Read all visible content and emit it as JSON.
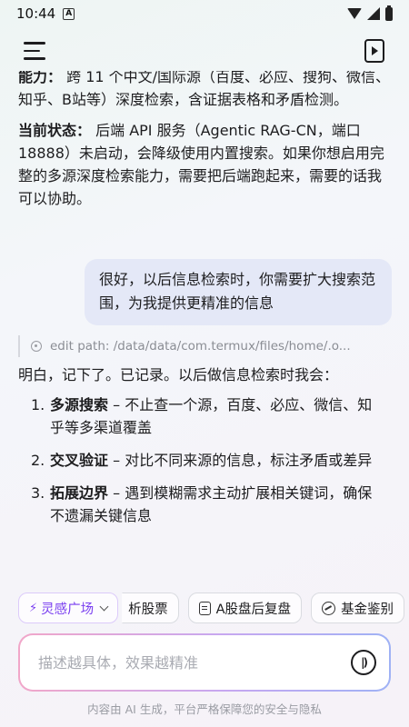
{
  "status_bar": {
    "time": "10:44",
    "app_badge": "A"
  },
  "header": {
    "menu_icon": "menu-icon",
    "video_icon": "video-icon"
  },
  "messages": {
    "cut_label": "能力：",
    "cut_text": " 跨 11 个中文/国际源（百度、必应、搜狗、微信、知乎、B站等）深度检索，含证据表格和矛盾检测。",
    "status_label": "当前状态：",
    "status_text": " 后端 API 服务（Agentic RAG-CN，端口 18888）未启动，会降级使用内置搜索。如果你想启用完整的多源深度检索能力，需要把后端跑起来，需要的话我可以协助。",
    "user_message": "很好，以后信息检索时，你需要扩大搜索范围，为我提供更精准的信息",
    "tool_call": "edit path: /data/data/com.termux/files/home/.o...",
    "reply_intro": "明白，记下了。已记录。以后做信息检索时我会：",
    "list": [
      {
        "num": "1.",
        "title": "多源搜索",
        "text": " – 不止查一个源，百度、必应、微信、知乎等多渠道覆盖"
      },
      {
        "num": "2.",
        "title": "交叉验证",
        "text": " – 对比不同来源的信息，标注矛盾或差异"
      },
      {
        "num": "3.",
        "title": "拓展边界",
        "text": " – 遇到模糊需求主动扩展相关键词，确保不遗漏关键信息"
      }
    ]
  },
  "chips": {
    "inspire": "灵感广场",
    "stock": "析股票",
    "a_share": "A股盘后复盘",
    "fund": "基金鉴别"
  },
  "input": {
    "placeholder": "描述越具体，效果越精准"
  },
  "footer": "内容由 AI 生成，平台严格保障您的安全与隐私",
  "colors": {
    "accent": "#7a3ff0",
    "user_bubble": "#e4e8f7"
  }
}
